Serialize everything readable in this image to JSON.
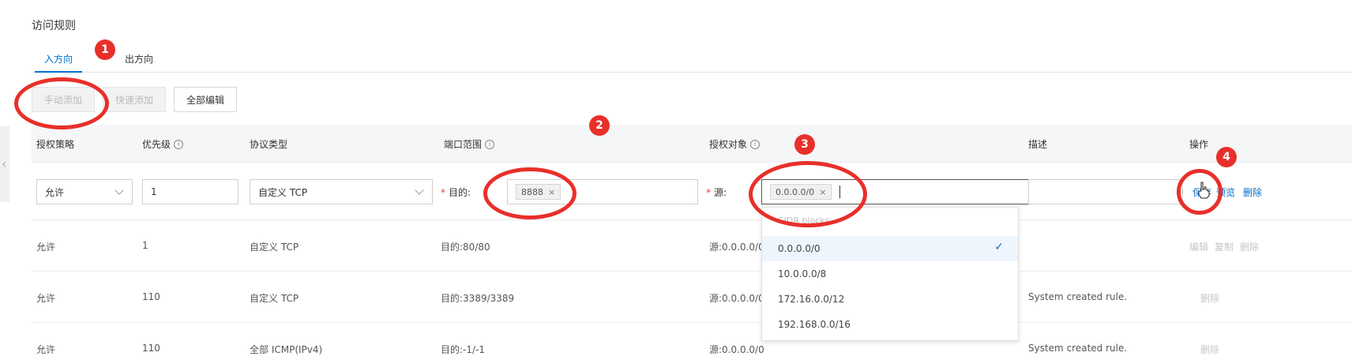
{
  "page_title": "访问规则",
  "tabs": [
    {
      "label": "入方向",
      "active": true
    },
    {
      "label": "出方向",
      "active": false
    }
  ],
  "toolbar": {
    "manual_add_label": "手动添加",
    "quick_add_label": "快速添加",
    "edit_all_label": "全部编辑"
  },
  "table": {
    "headers": {
      "policy": "授权策略",
      "priority": "优先级",
      "protocol": "协议类型",
      "port_range": "端口范围",
      "auth_object": "授权对象",
      "description": "描述",
      "actions": "操作"
    },
    "edit_row": {
      "policy": "允许",
      "priority": "1",
      "protocol": "自定义 TCP",
      "dest_label": "目的:",
      "dest_tag": "8888",
      "source_label": "源:",
      "source_tag": "0.0.0.0/0",
      "description": "",
      "save_label": "保存",
      "preview_label": "预览",
      "delete_label": "删除"
    },
    "rows": [
      {
        "policy": "允许",
        "priority": "1",
        "protocol": "自定义 TCP",
        "port": "目的:80/80",
        "source": "源:0.0.0.0/0",
        "description": "",
        "actions": [
          "编辑",
          "复制",
          "删除"
        ]
      },
      {
        "policy": "允许",
        "priority": "110",
        "protocol": "自定义 TCP",
        "port": "目的:3389/3389",
        "source": "源:0.0.0.0/0",
        "description": "System created rule.",
        "actions": [
          "删除"
        ]
      },
      {
        "policy": "允许",
        "priority": "110",
        "protocol": "全部 ICMP(IPv4)",
        "port": "目的:-1/-1",
        "source": "源:0.0.0.0/0",
        "description": "System created rule.",
        "actions": [
          "删除"
        ]
      }
    ]
  },
  "dropdown": {
    "header": "CIDR blocks",
    "options": [
      "0.0.0.0/0",
      "10.0.0.0/8",
      "172.16.0.0/12",
      "192.168.0.0/16"
    ],
    "selected": "0.0.0.0/0"
  },
  "annotations": [
    "1",
    "2",
    "3",
    "4"
  ],
  "colors": {
    "accent": "#0070cc",
    "annotation": "#e8302a",
    "required": "#e53e3e"
  },
  "icons": {
    "info": "i",
    "tag_close": "×",
    "check": "✓",
    "side_arrow": "‹"
  }
}
